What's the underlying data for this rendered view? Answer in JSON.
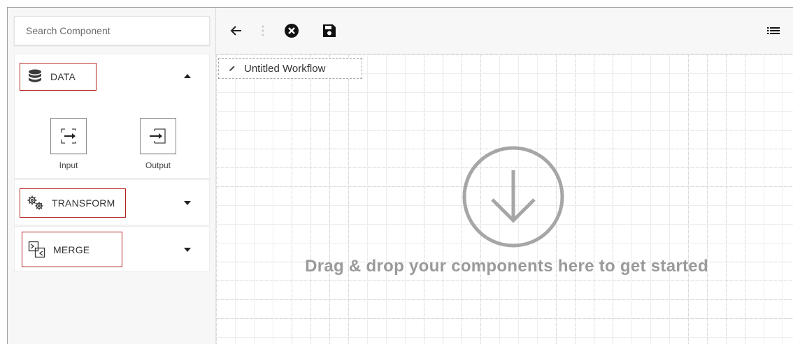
{
  "sidebar": {
    "search": {
      "placeholder": "Search Component",
      "value": ""
    },
    "sections": [
      {
        "label": "DATA",
        "icon": "database-icon",
        "expanded": true,
        "components": [
          {
            "label": "Input",
            "icon": "input-icon"
          },
          {
            "label": "Output",
            "icon": "output-icon"
          }
        ]
      },
      {
        "label": "TRANSFORM",
        "icon": "gears-icon",
        "expanded": false
      },
      {
        "label": "MERGE",
        "icon": "merge-icon",
        "expanded": false
      }
    ]
  },
  "toolbar": {
    "back_icon": "arrow-left-icon",
    "more_icon": "more-vertical-icon",
    "close_icon": "close-circle-icon",
    "save_icon": "save-icon",
    "list_icon": "list-icon"
  },
  "canvas": {
    "workflow_title": "Untitled Workflow",
    "empty_message": "Drag & drop your components here to get started"
  },
  "colors": {
    "highlight_border": "#b32222",
    "drop_icon": "#a6a6a6",
    "drop_text": "#9a9a9a"
  }
}
